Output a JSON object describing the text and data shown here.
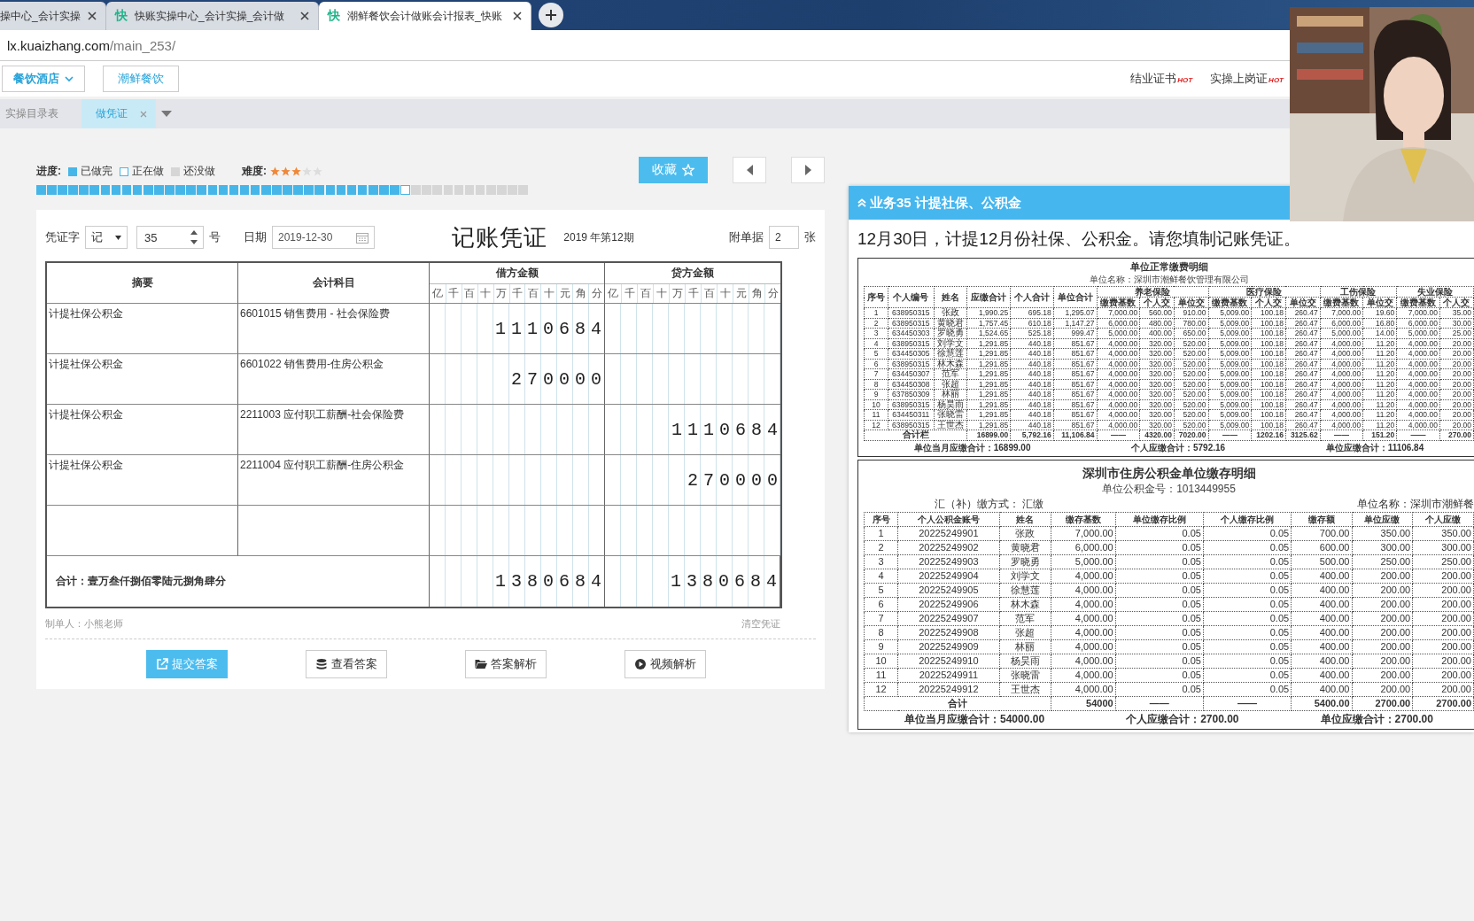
{
  "browser": {
    "tabs": [
      {
        "title": "操中心_会计实操",
        "selected": false
      },
      {
        "icon": "快",
        "title": "快账实操中心_会计实操_会计做",
        "selected": false
      },
      {
        "icon": "快",
        "title": "潮鲜餐饮会计做账会计报表_快账",
        "selected": true
      }
    ],
    "address": {
      "host": "lx.kuaizhang.com",
      "path": "/main_253/"
    }
  },
  "nav": {
    "dropdown": "餐饮酒店",
    "button": "潮鲜餐饮",
    "links": [
      {
        "label": "结业证书",
        "badge": "HOT"
      },
      {
        "label": "实操上岗证",
        "badge": "HOT"
      }
    ]
  },
  "subtabs": [
    {
      "label": "实操目录表",
      "selected": false,
      "closable": false
    },
    {
      "label": "做凭证",
      "selected": true,
      "closable": true
    }
  ],
  "progress": {
    "label": "进度:",
    "legend": [
      {
        "label": "已做完",
        "kind": "done"
      },
      {
        "label": "正在做",
        "kind": "current"
      },
      {
        "label": "还没做",
        "kind": "todo"
      }
    ],
    "cells": [
      {
        "kind": "done"
      },
      {
        "kind": "done"
      },
      {
        "kind": "done"
      },
      {
        "kind": "done"
      },
      {
        "kind": "done"
      },
      {
        "kind": "done"
      },
      {
        "kind": "done"
      },
      {
        "kind": "done"
      },
      {
        "kind": "done"
      },
      {
        "kind": "done"
      },
      {
        "kind": "done"
      },
      {
        "kind": "done"
      },
      {
        "kind": "done"
      },
      {
        "kind": "done"
      },
      {
        "kind": "done"
      },
      {
        "kind": "done"
      },
      {
        "kind": "done"
      },
      {
        "kind": "done"
      },
      {
        "kind": "done"
      },
      {
        "kind": "done"
      },
      {
        "kind": "done"
      },
      {
        "kind": "done"
      },
      {
        "kind": "done"
      },
      {
        "kind": "done"
      },
      {
        "kind": "done"
      },
      {
        "kind": "done"
      },
      {
        "kind": "done"
      },
      {
        "kind": "done"
      },
      {
        "kind": "done"
      },
      {
        "kind": "done"
      },
      {
        "kind": "done"
      },
      {
        "kind": "done"
      },
      {
        "kind": "done"
      },
      {
        "kind": "done"
      },
      {
        "kind": "current"
      },
      {
        "kind": "todo"
      },
      {
        "kind": "todo"
      },
      {
        "kind": "todo"
      },
      {
        "kind": "todo"
      },
      {
        "kind": "todo"
      },
      {
        "kind": "todo"
      },
      {
        "kind": "todo"
      },
      {
        "kind": "todo"
      },
      {
        "kind": "todo"
      },
      {
        "kind": "todo"
      },
      {
        "kind": "todo"
      }
    ]
  },
  "difficulty": {
    "label": "难度:",
    "stars": 3
  },
  "favorite_button": "收藏",
  "voucher": {
    "word_label": "凭证字",
    "word": "记",
    "number": "35",
    "number_unit": "号",
    "date_label": "日期",
    "date": "2019-12-30",
    "title": "记账凭证",
    "period": "2019 年第12期",
    "attach_label": "附单据",
    "attachments": "2",
    "attach_unit": "张",
    "columns": {
      "summary": "摘要",
      "account": "会计科目",
      "debit": "借方金额",
      "credit": "贷方金额",
      "debit_digits": [
        "亿",
        "千",
        "百",
        "十",
        "万",
        "千",
        "百",
        "十",
        "元",
        "角",
        "分"
      ],
      "credit_digits": [
        "亿",
        "千",
        "百",
        "十",
        "万",
        "千",
        "百",
        "十",
        "元",
        "角",
        "分"
      ]
    },
    "rows": [
      {
        "summary": "计提社保公积金",
        "account": "6601015 销售费用 - 社会保险费",
        "debit": "1110684"
      },
      {
        "summary": "计提社保公积金",
        "account": "6601022 销售费用-住房公积金",
        "debit": "270000"
      },
      {
        "summary": "计提社保公积金",
        "account": "2211003 应付职工薪酬-社会保险费",
        "credit": "1110684"
      },
      {
        "summary": "计提社保公积金",
        "account": "2211004 应付职工薪酬-住房公积金",
        "credit": "270000"
      }
    ],
    "total": {
      "label": "合计：壹万叁仟捌佰零陆元捌角肆分",
      "debit": "1380684",
      "credit": "1380684"
    },
    "preparer": "制单人：小熊老师",
    "clear": "清空凭证"
  },
  "actions": [
    {
      "label": "提交答案",
      "kind": "primary"
    },
    {
      "label": "查看答案",
      "kind": "default"
    },
    {
      "label": "答案解析",
      "kind": "default"
    },
    {
      "label": "视频解析",
      "kind": "default"
    }
  ],
  "task": {
    "title": "业务35 计提社保、公积金",
    "description": "12月30日，计提12月份社保、公积金。请您填制记账凭证。"
  },
  "documents": [
    {
      "kind": "social_insurance",
      "title": "单位正常缴费明细",
      "subtitle": "单位名称：深圳市潮鲜餐饮管理有限公司",
      "columns": [
        "序号",
        "个人编号",
        "姓名",
        "应缴合计",
        "个人合计",
        "单位合计"
      ],
      "groups": [
        {
          "label": "养老保险",
          "columns": [
            "缴费基数",
            "个人交",
            "单位交"
          ]
        },
        {
          "label": "医疗保险",
          "columns": [
            "缴费基数",
            "个人交",
            "单位交"
          ]
        },
        {
          "label": "工伤保险",
          "columns": [
            "缴费基数",
            "单位交"
          ]
        },
        {
          "label": "失业保险",
          "columns": [
            "缴费基数",
            "个人交"
          ]
        }
      ],
      "rows": [
        [
          "1",
          "638950315",
          "张政",
          "1,990.25",
          "695.18",
          "1,295.07",
          "7,000.00",
          "560.00",
          "910.00",
          "5,009.00",
          "100.18",
          "260.47",
          "7,000.00",
          "19.60",
          "7,000.00",
          "35.00"
        ],
        [
          "2",
          "638950315",
          "黄晓君",
          "1,757.45",
          "610.18",
          "1,147.27",
          "6,000.00",
          "480.00",
          "780.00",
          "5,009.00",
          "100.18",
          "260.47",
          "6,000.00",
          "16.80",
          "6,000.00",
          "30.00"
        ],
        [
          "3",
          "634450303",
          "罗晓勇",
          "1,524.65",
          "525.18",
          "999.47",
          "5,000.00",
          "400.00",
          "650.00",
          "5,009.00",
          "100.18",
          "260.47",
          "5,000.00",
          "14.00",
          "5,000.00",
          "25.00"
        ],
        [
          "4",
          "638950315",
          "刘学文",
          "1,291.85",
          "440.18",
          "851.67",
          "4,000.00",
          "320.00",
          "520.00",
          "5,009.00",
          "100.18",
          "260.47",
          "4,000.00",
          "11.20",
          "4,000.00",
          "20.00"
        ],
        [
          "5",
          "634450305",
          "徐慧莲",
          "1,291.85",
          "440.18",
          "851.67",
          "4,000.00",
          "320.00",
          "520.00",
          "5,009.00",
          "100.18",
          "260.47",
          "4,000.00",
          "11.20",
          "4,000.00",
          "20.00"
        ],
        [
          "6",
          "638950315",
          "林木森",
          "1,291.85",
          "440.18",
          "851.67",
          "4,000.00",
          "320.00",
          "520.00",
          "5,009.00",
          "100.18",
          "260.47",
          "4,000.00",
          "11.20",
          "4,000.00",
          "20.00"
        ],
        [
          "7",
          "634450307",
          "范军",
          "1,291.85",
          "440.18",
          "851.67",
          "4,000.00",
          "320.00",
          "520.00",
          "5,009.00",
          "100.18",
          "260.47",
          "4,000.00",
          "11.20",
          "4,000.00",
          "20.00"
        ],
        [
          "8",
          "634450308",
          "张超",
          "1,291.85",
          "440.18",
          "851.67",
          "4,000.00",
          "320.00",
          "520.00",
          "5,009.00",
          "100.18",
          "260.47",
          "4,000.00",
          "11.20",
          "4,000.00",
          "20.00"
        ],
        [
          "9",
          "637850309",
          "林丽",
          "1,291.85",
          "440.18",
          "851.67",
          "4,000.00",
          "320.00",
          "520.00",
          "5,009.00",
          "100.18",
          "260.47",
          "4,000.00",
          "11.20",
          "4,000.00",
          "20.00"
        ],
        [
          "10",
          "638950315",
          "杨昊雨",
          "1,291.85",
          "440.18",
          "851.67",
          "4,000.00",
          "320.00",
          "520.00",
          "5,009.00",
          "100.18",
          "260.47",
          "4,000.00",
          "11.20",
          "4,000.00",
          "20.00"
        ],
        [
          "11",
          "634450311",
          "张晓雷",
          "1,291.85",
          "440.18",
          "851.67",
          "4,000.00",
          "320.00",
          "520.00",
          "5,009.00",
          "100.18",
          "260.47",
          "4,000.00",
          "11.20",
          "4,000.00",
          "20.00"
        ],
        [
          "12",
          "638950315",
          "王世杰",
          "1,291.85",
          "440.18",
          "851.67",
          "4,000.00",
          "320.00",
          "520.00",
          "5,009.00",
          "100.18",
          "260.47",
          "4,000.00",
          "11.20",
          "4,000.00",
          "20.00"
        ]
      ],
      "total": [
        "合计栏",
        "16899.00",
        "5,792.16",
        "11,106.84",
        "——",
        "4320.00",
        "7020.00",
        "——",
        "1202.16",
        "3125.62",
        "——",
        "151.20",
        "——",
        "270.00"
      ],
      "footer": [
        "单位当月应缴合计：16899.00",
        "个人应缴合计：5792.16",
        "单位应缴合计：11106.84"
      ]
    },
    {
      "kind": "housing_fund",
      "title": "深圳市住房公积金单位缴存明细",
      "subtitle": "单位公积金号：1013449955",
      "method": "汇（补）缴方式： 汇缴",
      "company": "单位名称：深圳市潮鲜餐",
      "columns": [
        "序号",
        "个人公积金账号",
        "姓名",
        "缴存基数",
        "单位缴存比例",
        "个人缴存比例",
        "缴存额",
        "单位应缴",
        "个人应缴"
      ],
      "rows": [
        [
          "1",
          "20225249901",
          "张政",
          "7,000.00",
          "0.05",
          "0.05",
          "700.00",
          "350.00",
          "350.00"
        ],
        [
          "2",
          "20225249902",
          "黄晓君",
          "6,000.00",
          "0.05",
          "0.05",
          "600.00",
          "300.00",
          "300.00"
        ],
        [
          "3",
          "20225249903",
          "罗晓勇",
          "5,000.00",
          "0.05",
          "0.05",
          "500.00",
          "250.00",
          "250.00"
        ],
        [
          "4",
          "20225249904",
          "刘学文",
          "4,000.00",
          "0.05",
          "0.05",
          "400.00",
          "200.00",
          "200.00"
        ],
        [
          "5",
          "20225249905",
          "徐慧莲",
          "4,000.00",
          "0.05",
          "0.05",
          "400.00",
          "200.00",
          "200.00"
        ],
        [
          "6",
          "20225249906",
          "林木森",
          "4,000.00",
          "0.05",
          "0.05",
          "400.00",
          "200.00",
          "200.00"
        ],
        [
          "7",
          "20225249907",
          "范军",
          "4,000.00",
          "0.05",
          "0.05",
          "400.00",
          "200.00",
          "200.00"
        ],
        [
          "8",
          "20225249908",
          "张超",
          "4,000.00",
          "0.05",
          "0.05",
          "400.00",
          "200.00",
          "200.00"
        ],
        [
          "9",
          "20225249909",
          "林丽",
          "4,000.00",
          "0.05",
          "0.05",
          "400.00",
          "200.00",
          "200.00"
        ],
        [
          "10",
          "20225249910",
          "杨昊雨",
          "4,000.00",
          "0.05",
          "0.05",
          "400.00",
          "200.00",
          "200.00"
        ],
        [
          "11",
          "20225249911",
          "张晓雷",
          "4,000.00",
          "0.05",
          "0.05",
          "400.00",
          "200.00",
          "200.00"
        ],
        [
          "12",
          "20225249912",
          "王世杰",
          "4,000.00",
          "0.05",
          "0.05",
          "400.00",
          "200.00",
          "200.00"
        ]
      ],
      "total": [
        "合计",
        "54000",
        "——",
        "——",
        "5400.00",
        "2700.00",
        "2700.00"
      ],
      "footer": [
        "单位当月应缴合计：54000.00",
        "个人应缴合计：2700.00",
        "单位应缴合计：2700.00"
      ]
    }
  ]
}
